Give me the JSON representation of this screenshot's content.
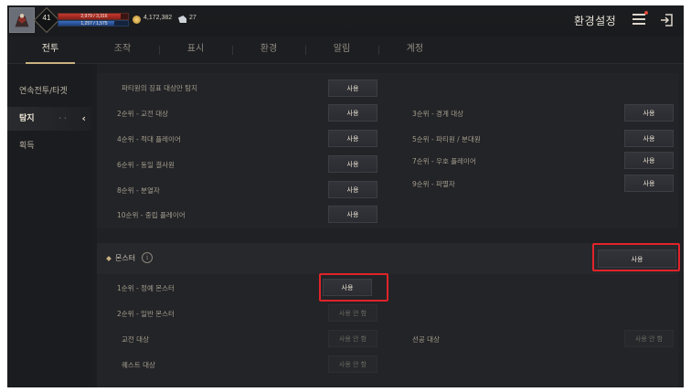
{
  "player": {
    "level": "41",
    "hp_text": "2,979 / 3,316",
    "mp_text": "1,257 / 1,575",
    "hp_fraction": 0.9,
    "mp_fraction": 0.8,
    "gold": "4,172,382",
    "tickets": "27"
  },
  "header": {
    "title": "환경설정"
  },
  "tabs": [
    "전투",
    "조작",
    "표시",
    "환경",
    "알림",
    "계정"
  ],
  "sidebar": {
    "items": [
      "연속전투/타겟",
      "탐지",
      "획득"
    ]
  },
  "section_targets": {
    "party_target_label": "파티원의 징표 대상만 탐지",
    "party_target_btn": "사용",
    "left": [
      {
        "label": "2순위 - 교전 대상",
        "btn": "사용"
      },
      {
        "label": "4순위 - 적대 플레이어",
        "btn": "사용"
      },
      {
        "label": "6순위 - 동일 결사원",
        "btn": "사용"
      },
      {
        "label": "8순위 - 분열자",
        "btn": "사용"
      },
      {
        "label": "10순위 - 중립 플레이어",
        "btn": "사용"
      }
    ],
    "right": [
      {
        "label": "3순위 - 경계 대상",
        "btn": "사용"
      },
      {
        "label": "5순위 - 파티원 / 분대원",
        "btn": "사용"
      },
      {
        "label": "7순위 - 우호 플레이어",
        "btn": "사용"
      },
      {
        "label": "9순위 - 파멸자",
        "btn": "사용"
      }
    ]
  },
  "monster": {
    "title": "몬스터",
    "info_glyph": "i",
    "toggle": "사용",
    "rows": [
      {
        "label": "1순위 - 정예 몬스터",
        "btn": "사용"
      },
      {
        "label": "2순위 - 일반 몬스터",
        "btn": "사용 안 함"
      },
      {
        "label": "교전 대상",
        "btn": "사용 안 함"
      },
      {
        "label": "퀘스트 대상",
        "btn": "사용 안 함"
      }
    ],
    "preemptive_label": "선공 대상",
    "preemptive_btn": "사용 안 함"
  },
  "colors": {
    "highlight": "#e0232a",
    "accent": "#c9b282"
  }
}
